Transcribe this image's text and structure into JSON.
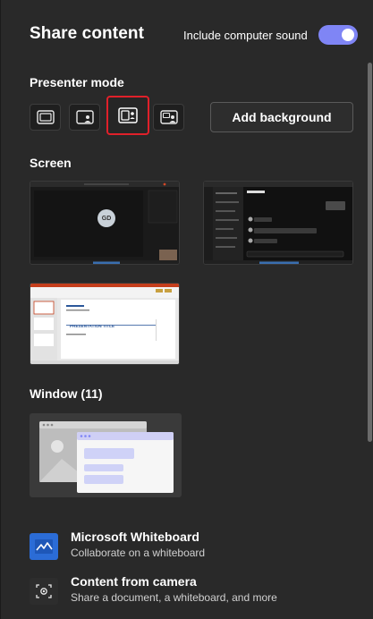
{
  "header": {
    "title": "Share content",
    "sound_label": "Include computer sound",
    "sound_on": true
  },
  "presenter": {
    "label": "Presenter mode",
    "modes": [
      {
        "name": "content-only",
        "icon": "content-only-icon"
      },
      {
        "name": "standout",
        "icon": "standout-icon"
      },
      {
        "name": "side-by-side",
        "icon": "side-by-side-icon",
        "selected": true
      },
      {
        "name": "reporter",
        "icon": "reporter-icon"
      }
    ],
    "add_background": "Add background"
  },
  "screen": {
    "label": "Screen",
    "thumbs": [
      {
        "name": "screen-1",
        "avatar_initials": "GD"
      },
      {
        "name": "screen-2"
      },
      {
        "name": "screen-3",
        "slide_title": "PRESENTATION TITLE"
      }
    ]
  },
  "window": {
    "label": "Window (11)"
  },
  "options": [
    {
      "title": "Microsoft Whiteboard",
      "subtitle": "Collaborate on a whiteboard",
      "icon": "whiteboard-icon"
    },
    {
      "title": "Content from camera",
      "subtitle": "Share a document, a whiteboard, and more",
      "icon": "camera-icon"
    }
  ],
  "colors": {
    "accent": "#7f85f5",
    "selected_border": "#e0202a",
    "whiteboard_blue": "#2b6cd6"
  }
}
